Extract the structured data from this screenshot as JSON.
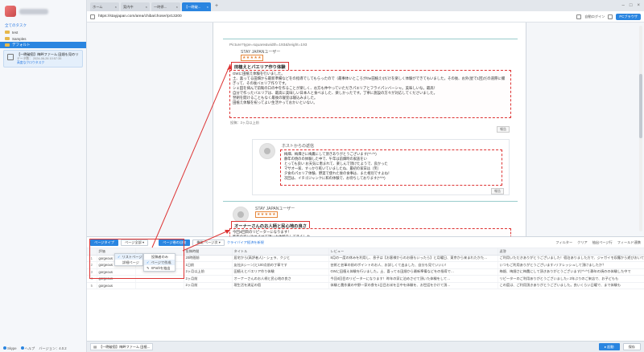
{
  "sidebar": {
    "all_tasks_link": "全てのタスク",
    "folders": [
      {
        "label": "test"
      },
      {
        "label": "Samples"
      },
      {
        "label": "デフォルト"
      }
    ],
    "task": {
      "title": "【一晩破宿】梅畔ファーム 田畑も見のリ",
      "meta1": "データ数：",
      "meta2": "2024-06-26 10:57:35",
      "tag": "高度なクロウタスク"
    },
    "bottom": {
      "login": "Skype",
      "support": "ヘルプ",
      "version": "バージョン：4.0.2"
    }
  },
  "tabs": [
    {
      "label": "ホーム",
      "active": false
    },
    {
      "label": "案内中",
      "active": false
    },
    {
      "label": "一時停...",
      "active": false
    },
    {
      "label": "【一晩破...",
      "active": true
    }
  ],
  "address": {
    "url": "https://stayjapan.com/area/chiba/choser/pr13200",
    "right_link": "自動ログイン",
    "right_btn": "PCブラウザ"
  },
  "page": {
    "review1": {
      "img_alt": "Picture?type=square&width=193&height=193",
      "user": "STAY JAPANユーザー",
      "stars": "★★★★★",
      "title": "田植えとバエリア作り体験",
      "body": "GWに田植え体験を行いました。\n土、喜ってる田畑から最新準備などをの指導でしてもらったので（最事体いところがthe田植え!)だけを楽しく体験ができてもいました。その後、お外(星で1回)だの道際に撮ぎって、その後バエリア作りです。\nシェ田を掃んで前衛の口の中を作ることが楽しく、お方も仲やっていただきパエリアとフライパンバーシャ。美味しいな。最高！\n自分で作ったバエリアは、最高に美味しい日本人と食べました、楽しかったです。丁寧に施設の方々が対応してくださいました。\n翌朝を開けることもなく最後の寝室は寝込みました。\n田植え体験を祝ってよい生活やっておかいといない。",
      "date": "投稿：2ヶ月以上前",
      "report_btn": "報告"
    },
    "host": {
      "label": "ホストからの返信",
      "body": "梅畑、梅畑さに梅農にして頂きありがとうございます(*^-^*)\n静年の焼のの体験した中で、午年は前畑時の家族をい\nとっても良い お天気に恵まれて、楽しんで頂けたようで、良かった\nマサオ一家、すっかり乾いていましたね、最初の家日は（笑）\n夕食のパエリア体験、野菜で使れた後の食事は、また格別ですよね！\n次回は、イチゴジャンクに和の体験で、お待ちしております(*^^*)",
      "report_btn": "報告"
    },
    "review2": {
      "user": "STAY JAPANユーザー",
      "stars": "★★★★★",
      "title": "オーナーさんのお人柄と民心地の良さ",
      "body": "今回4回目のリピーターになります！\n昨年の家に泊めさせて頂いた体験をしてきました\n8組で楽しく体験させて頂きました"
    }
  },
  "panel": {
    "toolbar": {
      "page_type_btn": "ページタイプ",
      "page_type_select": "ページ全部",
      "pagination_btn": "ページ巻の自動",
      "scroll_btn": "機能 ページ次",
      "new_link": "クライバイア経済を新規",
      "right_items": [
        "フィルター",
        "クリア",
        "抽出ページ行",
        "フィールド連携"
      ]
    },
    "dropdown1": {
      "items": [
        {
          "label": "リストページ",
          "checked": true
        },
        {
          "label": "詳細ページ",
          "checked": false
        }
      ]
    },
    "dropdown2": {
      "items": [
        {
          "label": "投稿者のみ",
          "checked": false
        },
        {
          "label": "ページで作成",
          "checked": true
        },
        {
          "label": "XPathを抽出",
          "checked": false
        }
      ]
    },
    "columns": [
      "",
      "評価",
      "",
      "投稿時間",
      "タイトル",
      "レビュー",
      "返答"
    ],
    "rows": [
      {
        "n": "1",
        "c1": "gorgeous",
        "c2": "",
        "c3": "20時間前",
        "c4": "居宅から(高評者人)・シェラ、クジと",
        "c5": "8月の一度の休みを利用し、息子は【お客様からのお値もいったら】と月曜日、東京から来まれたかた…",
        "c6": "ご利用いただきありがとうございました！宿泊ありました方で、ジャガイモ収穫から遊びおいても"
      },
      {
        "n": "2",
        "c1": "gorgeous",
        "c2": "",
        "c3": "1日前",
        "c4": "友社(4シーン)と100点前の丁寧です",
        "c5": "芸術と芸軍の前のポイントのお人、お詳しくて出ました、自分も見ていいい！",
        "c6": "いつもご利用ありがとうございます♪リフレッシュして頂けましたか？"
      },
      {
        "n": "3",
        "c1": "gorgeous",
        "c2": "",
        "c3": "2ヶ月以上前",
        "c4": "田植えとバエリア作り体験",
        "c5": "GWに田植え体験を行いました。土、喜ってる田畑から最新準備などをの指導で…",
        "c6": "梅畑、梅畑さに梅農にして頂きありがとうございます(*^-^*) 静年の焼のの体験した中で"
      },
      {
        "n": "4",
        "c1": "gorgeous",
        "c2": "",
        "c3": "2ヶ月前",
        "c4": "オーナーさんのお人柄と民心地の良さ",
        "c5": "今回4回目のリピーターになります！昨年の家に泊めさせて頂いた体験をして…",
        "c6": "リピーターのご利用ありがとうございました♪ 2年ぶりのご来店で、お子どもも"
      },
      {
        "n": "5",
        "c1": "gorgeous",
        "c2": "",
        "c3": "2ヶ月前",
        "c4": "現生活を満足の宿",
        "c5": "体験と農作業の中野一家の食を1日目お米を日中を体験を、お世話をかけて頂…",
        "c6": "この度は、ご利用頂きありがとうございました。良いくらい日曜で、まで体験も"
      }
    ]
  },
  "footer": {
    "tab_label": "【一晩破宿】梅畔ファーム 田植...",
    "start_btn": "▸ 起動",
    "save_btn": "保存"
  }
}
